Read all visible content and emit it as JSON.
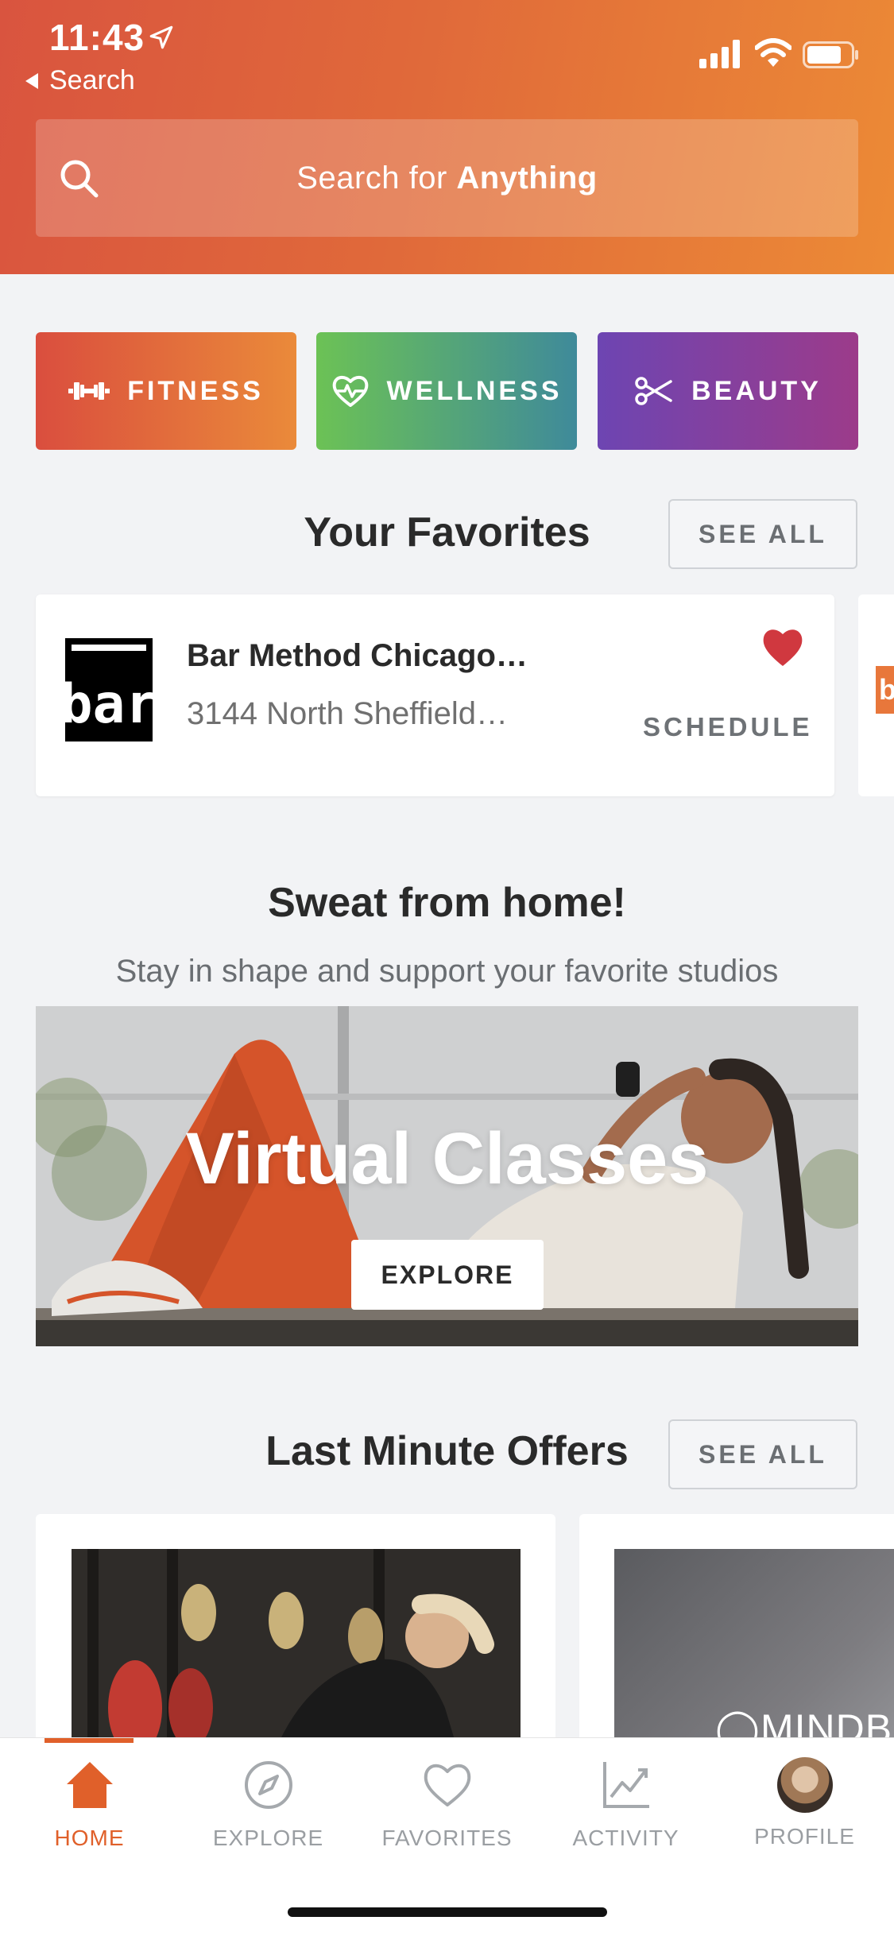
{
  "status_bar": {
    "time": "11:43",
    "back_label": "Search"
  },
  "search": {
    "prefix": "Search for ",
    "emphasis": "Anything"
  },
  "categories": [
    {
      "label": "FITNESS",
      "icon": "dumbbell-icon"
    },
    {
      "label": "WELLNESS",
      "icon": "heart-pulse-icon"
    },
    {
      "label": "BEAUTY",
      "icon": "scissors-icon"
    }
  ],
  "favorites": {
    "title": "Your Favorites",
    "see_all": "SEE ALL",
    "card": {
      "logo_text": "bar",
      "name": "Bar Method Chicago…",
      "address": "3144 North Sheffield…",
      "action": "SCHEDULE"
    },
    "peek_logo_text": "b"
  },
  "sweat": {
    "title": "Sweat from home!",
    "subtitle": "Stay in shape and support your favorite studios",
    "banner_title": "Virtual Classes",
    "banner_button": "EXPLORE"
  },
  "offers": {
    "title": "Last Minute Offers",
    "see_all": "SEE ALL",
    "card2_watermark": "MINDBO"
  },
  "tabbar": {
    "tabs": [
      {
        "label": "HOME",
        "icon": "home-icon",
        "active": true
      },
      {
        "label": "EXPLORE",
        "icon": "compass-icon",
        "active": false
      },
      {
        "label": "FAVORITES",
        "icon": "heart-icon",
        "active": false
      },
      {
        "label": "ACTIVITY",
        "icon": "chart-icon",
        "active": false
      },
      {
        "label": "PROFILE",
        "icon": "avatar",
        "active": false
      }
    ]
  },
  "colors": {
    "accent": "#e0602a",
    "favorite_heart": "#d0383f"
  }
}
